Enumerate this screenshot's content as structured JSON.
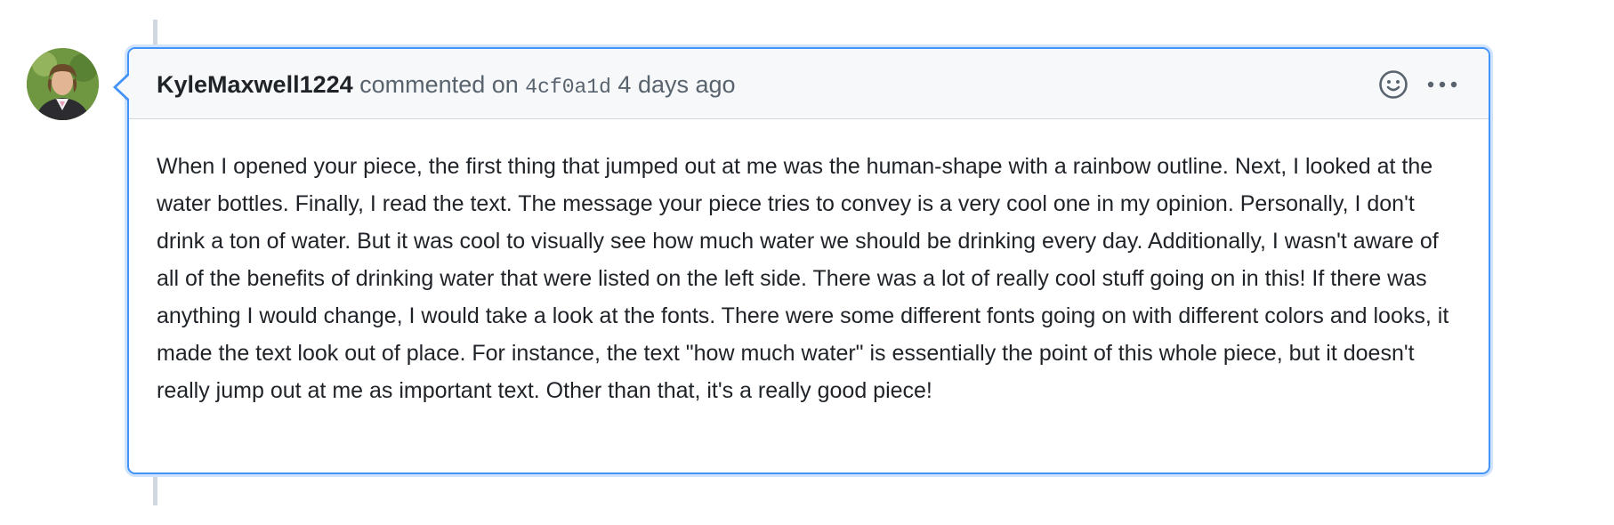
{
  "comment": {
    "author": "KyleMaxwell1224",
    "action_text": "commented on",
    "commit_sha": "4cf0a1d",
    "timestamp": "4 days ago",
    "body": "When I opened your piece, the first thing that jumped out at me was the human-shape with a rainbow outline. Next, I looked at the water bottles. Finally, I read the text. The message your piece tries to convey is a very cool one in my opinion. Personally, I don't drink a ton of water. But it was cool to visually see how much water we should be drinking every day. Additionally, I wasn't aware of all of the benefits of drinking water that were listed on the left side. There was a lot of really cool stuff going on in this! If there was anything I would change, I would take a look at the fonts. There were some different fonts going on with different colors and looks, it made the text look out of place. For instance, the text \"how much water\" is essentially the point of this whole piece, but it doesn't really jump out at me as important text. Other than that, it's a really good piece!"
  },
  "icons": {
    "avatar": "user-avatar-photo",
    "reaction": "smiley-icon",
    "menu": "kebab-horizontal-icon"
  },
  "colors": {
    "focus_border": "#4493f8",
    "header_bg": "#f6f8fa",
    "timeline": "#d0d7de"
  }
}
